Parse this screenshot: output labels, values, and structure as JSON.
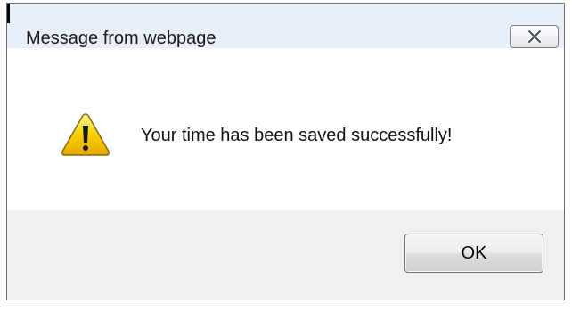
{
  "dialog": {
    "title": "Message from webpage",
    "message": "Your time has been saved successfully!",
    "ok_label": "OK",
    "close_icon": "close-icon",
    "message_icon": "warning-icon"
  },
  "colors": {
    "titlebar": "#e8eff8",
    "footer": "#f0f0f0",
    "warning_yellow": "#f5c400"
  }
}
